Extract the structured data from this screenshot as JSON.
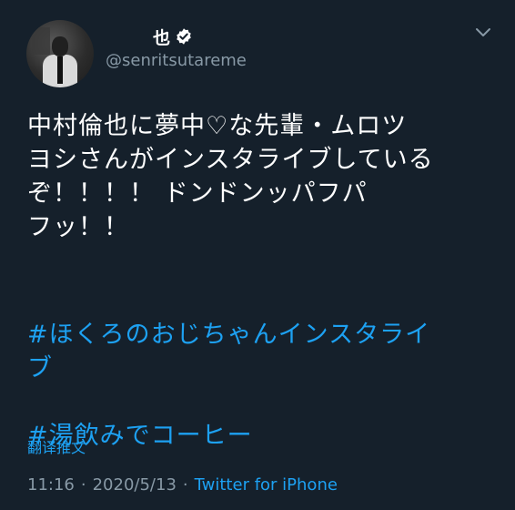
{
  "author": {
    "display_name": "也",
    "handle": "@senritsutareme",
    "verified": true
  },
  "tweet": {
    "text": "中村倫也に夢中♡な先輩・ムロツ\nヨシさんがインスタライブしている\nぞ！！！！ ドンドンッパフパ\nフッ！！",
    "hashtags": [
      "#ほくろのおじちゃんインスタライ\nブ",
      "#湯飲みでコーヒー"
    ],
    "translate_label": "翻译推文",
    "time": "11:16",
    "date": "2020/5/13",
    "separator": "·",
    "source": "Twitter for iPhone"
  },
  "icons": {
    "verified": "verified-badge-icon",
    "caret": "chevron-down-icon"
  },
  "colors": {
    "background": "#15202b",
    "accent": "#1da1f2",
    "secondary_text": "#8899a6"
  }
}
